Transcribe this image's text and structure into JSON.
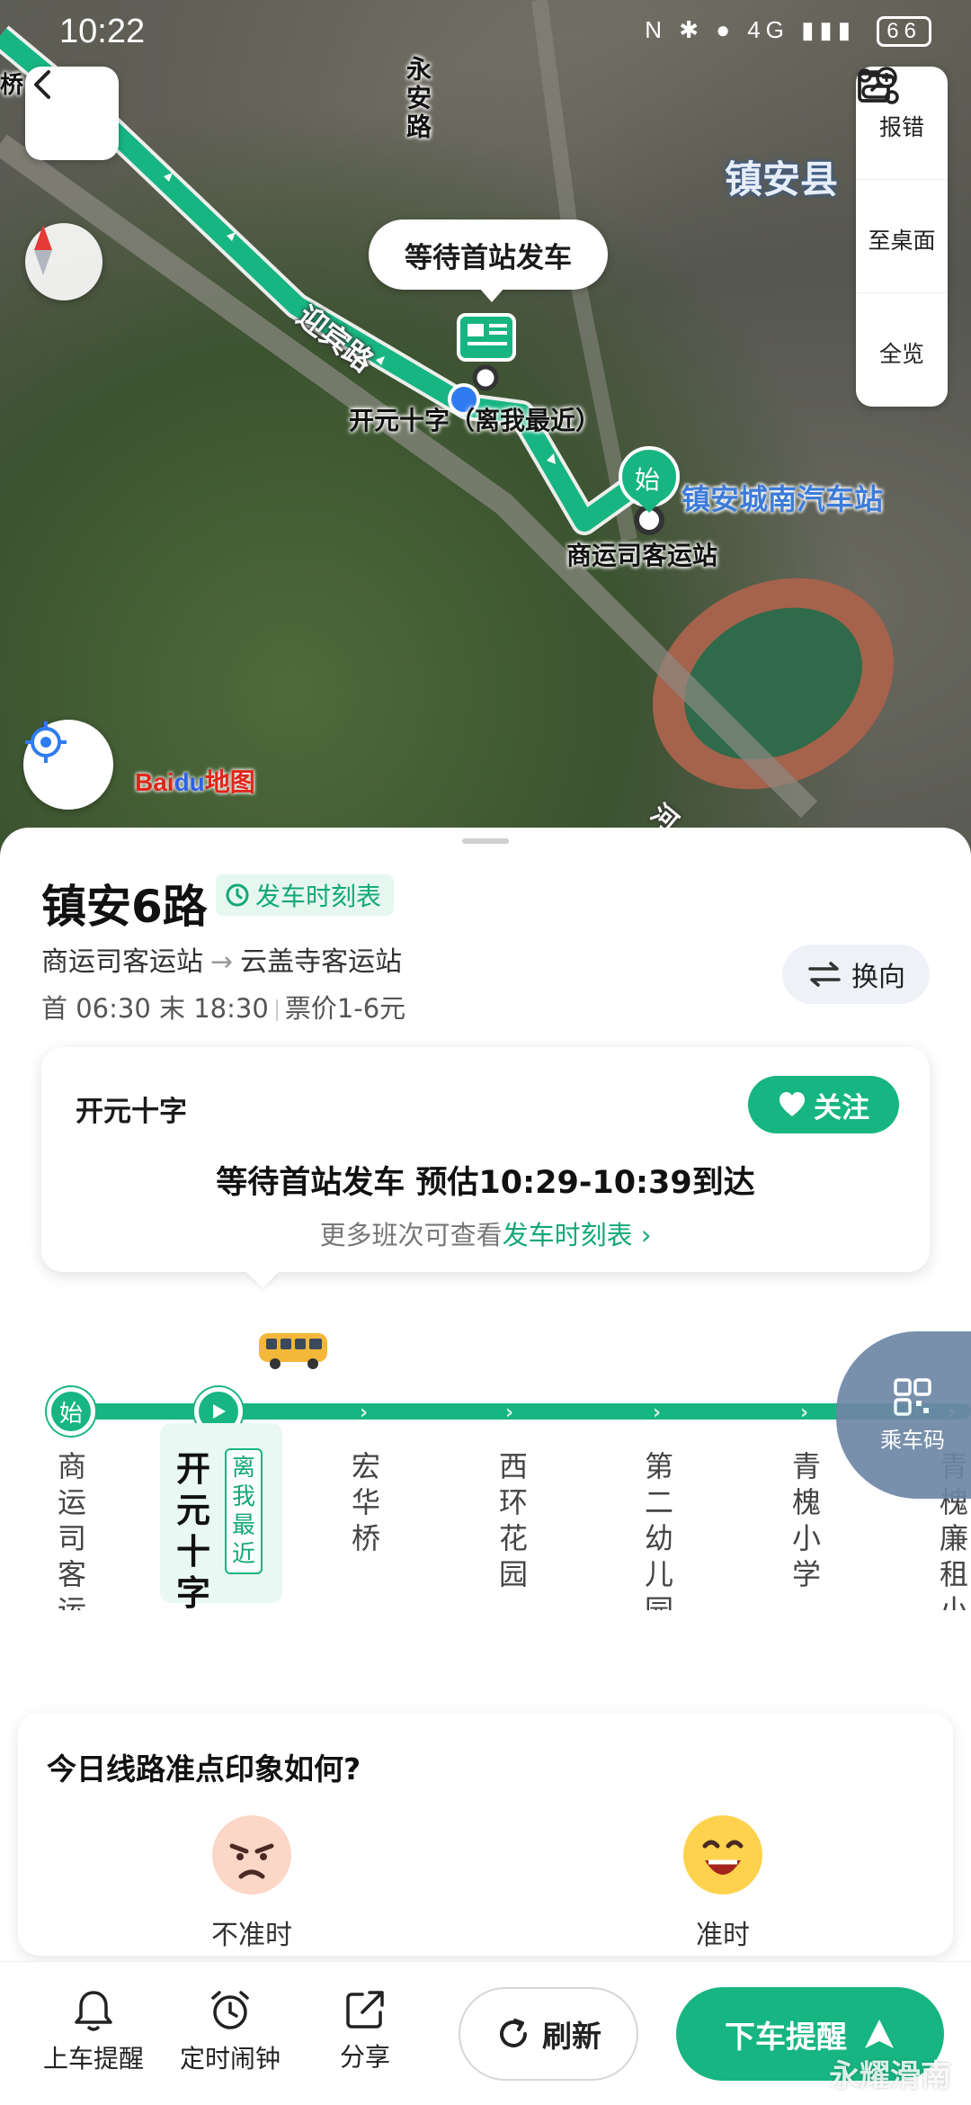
{
  "status_bar": {
    "time": "10:22",
    "battery": "66",
    "network": "4G"
  },
  "map": {
    "bubble": "等待首站发车",
    "labels": {
      "county": "镇安县",
      "road_yongan": "永安路",
      "road_yingbin": "迎宾路",
      "current_stop": "开元十字（离我最近）",
      "terminal": "镇安城南汽车站",
      "start_stop": "商运司客运站",
      "start_marker": "始",
      "bridge": "桥",
      "river": "河"
    },
    "tools": [
      {
        "icon": "report-icon",
        "label": "报错"
      },
      {
        "icon": "add-to-desktop-icon",
        "label": "至桌面"
      },
      {
        "icon": "overview-icon",
        "label": "全览"
      }
    ],
    "logo": {
      "bai": "Bai",
      "du": "du",
      "map": "地图"
    }
  },
  "route": {
    "name": "镇安6路",
    "timetable_label": "发车时刻表",
    "from": "商运司客运站",
    "to": "云盖寺客运站",
    "first": "首 06:30",
    "last": "末 18:30",
    "fare": "票价1-6元",
    "switch_label": "换向"
  },
  "info_card": {
    "stop": "开元十字",
    "follow_label": "关注",
    "eta": "等待首站发车 预估10:29-10:39到达",
    "more_prefix": "更多班次可查看",
    "more_link": "发车时刻表",
    "more_chevron": "›"
  },
  "line": {
    "start_marker": "始",
    "near_tag": "离我最近",
    "stations": [
      "商运司客运站",
      "开元十字",
      "宏华桥",
      "西环花园",
      "第二幼儿园",
      "青槐小学",
      "青槐廉租小区"
    ]
  },
  "ride_code": {
    "label": "乘车码"
  },
  "feedback": {
    "title": "今日线路准点印象如何?",
    "options": [
      {
        "label": "不准时",
        "face": "angry-face-icon"
      },
      {
        "label": "准时",
        "face": "laughing-face-icon"
      }
    ]
  },
  "bottom_bar": {
    "board_alert": "上车提醒",
    "alarm": "定时闹钟",
    "share": "分享",
    "refresh": "刷新",
    "alight_alert": "下车提醒"
  },
  "watermark": "永耀滑南",
  "colors": {
    "accent": "#17b582",
    "accent_text": "#12a876",
    "ride_code_bg": "#6e87a6"
  }
}
